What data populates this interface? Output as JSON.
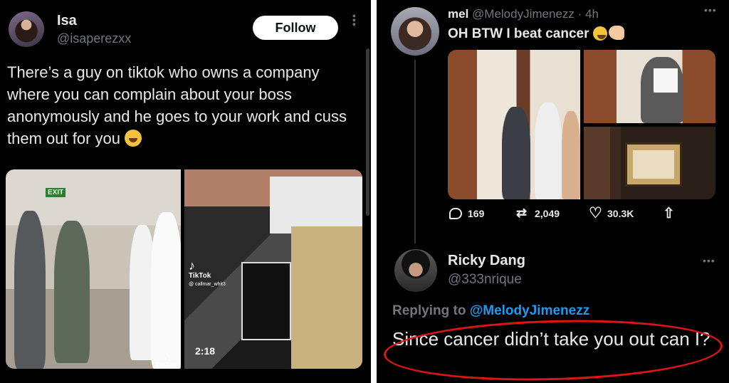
{
  "left_tweet": {
    "display_name": "Isa",
    "handle": "@isaperezxx",
    "follow_label": "Follow",
    "text": "There’s a guy on tiktok who owns a company where you can complain about your boss anonymously and he goes to your work and cuss them out for you",
    "text_emoji": "laughing-tears-emoji",
    "media": {
      "exit_sign": "EXIT",
      "tiktok_label_1": "TikTok",
      "tiktok_user": "@ callmar_whit3",
      "tiktok_label_2": "TikTok",
      "duration": "2:18"
    }
  },
  "right_tweet": {
    "display_name": "mel",
    "handle": "@MelodyJimenezz",
    "time": "· 4h",
    "text": "OH BTW I beat cancer",
    "text_emojis": [
      "pleading-face-emoji",
      "flexed-biceps-emoji"
    ],
    "actions": {
      "replies": "169",
      "retweets": "2,049",
      "likes": "30.3K"
    }
  },
  "reply_tweet": {
    "display_name": "Ricky Dang",
    "handle": "@333nrique",
    "replying_prefix": "Replying to",
    "replying_to": "@MelodyJimenezz",
    "text": "Since cancer didn’t take you out can I?"
  },
  "colors": {
    "background": "#000000",
    "text": "#e7e9ea",
    "secondary": "#71767b",
    "link": "#1d9bf0",
    "annotation": "#e01414"
  }
}
